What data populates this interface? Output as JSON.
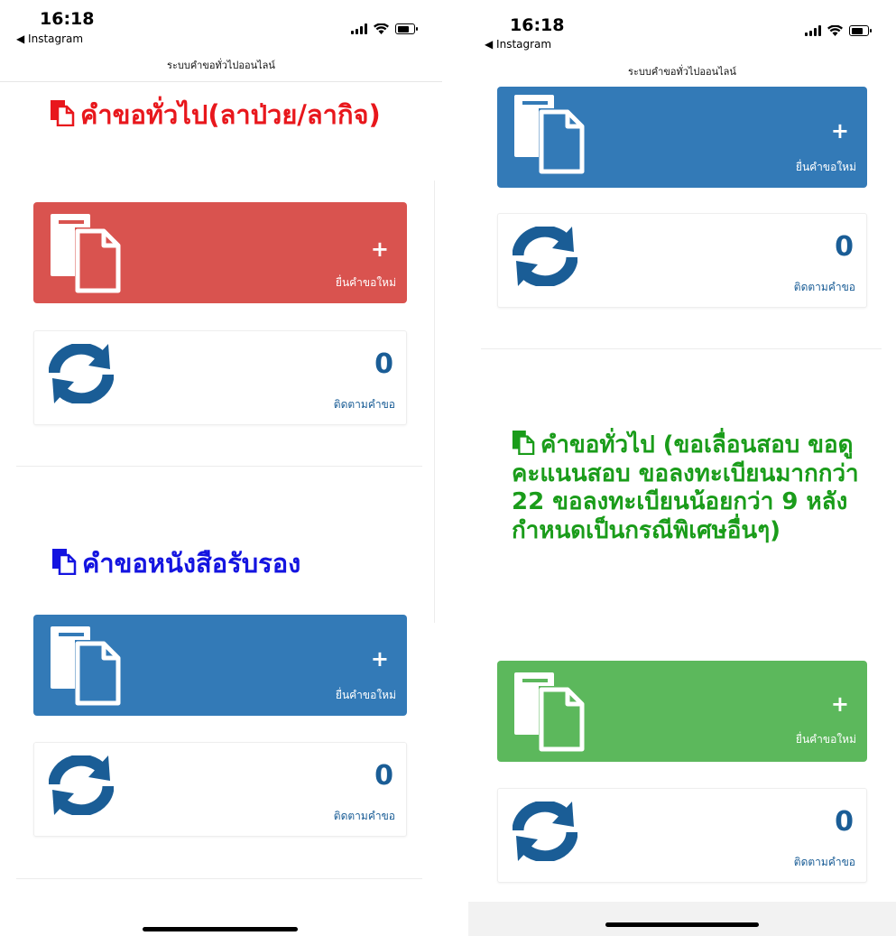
{
  "status_bar": {
    "time": "16:18",
    "back_app": "◀ Instagram"
  },
  "page": {
    "title": "ระบบคำขอทั่วไปออนไลน์"
  },
  "sections": {
    "sick_leave": {
      "title": "คำขอทั่วไป(ลาป่วย/ลากิจ)",
      "color": "#e8171c",
      "card_color": "#d9534f"
    },
    "certificate": {
      "title": "คำขอหนังสือรับรอง",
      "color": "#1414e0",
      "card_color": "#337ab7"
    },
    "general_exam": {
      "title": "คำขอทั่วไป (ขอเลื่อนสอบ ขอดูคะแนนสอบ ขอลงทะเบียนมากกว่า 22 ขอลงทะเบียนน้อยกว่า 9 หลังกำหนดเป็นกรณีพิเศษอื่นๆ)",
      "color": "#1a9c1a",
      "card_color": "#5cb85c"
    }
  },
  "labels": {
    "new_request": "ยื่นคำขอใหม่",
    "plus": "+",
    "track_request": "ติดตามคำขอ"
  },
  "counts": {
    "sick_leave": "0",
    "certificate": "0",
    "blue_top_right": "0",
    "general_exam": "0"
  },
  "icons": {
    "document": "document-icon",
    "sync": "sync-icon",
    "plus": "plus-icon"
  }
}
